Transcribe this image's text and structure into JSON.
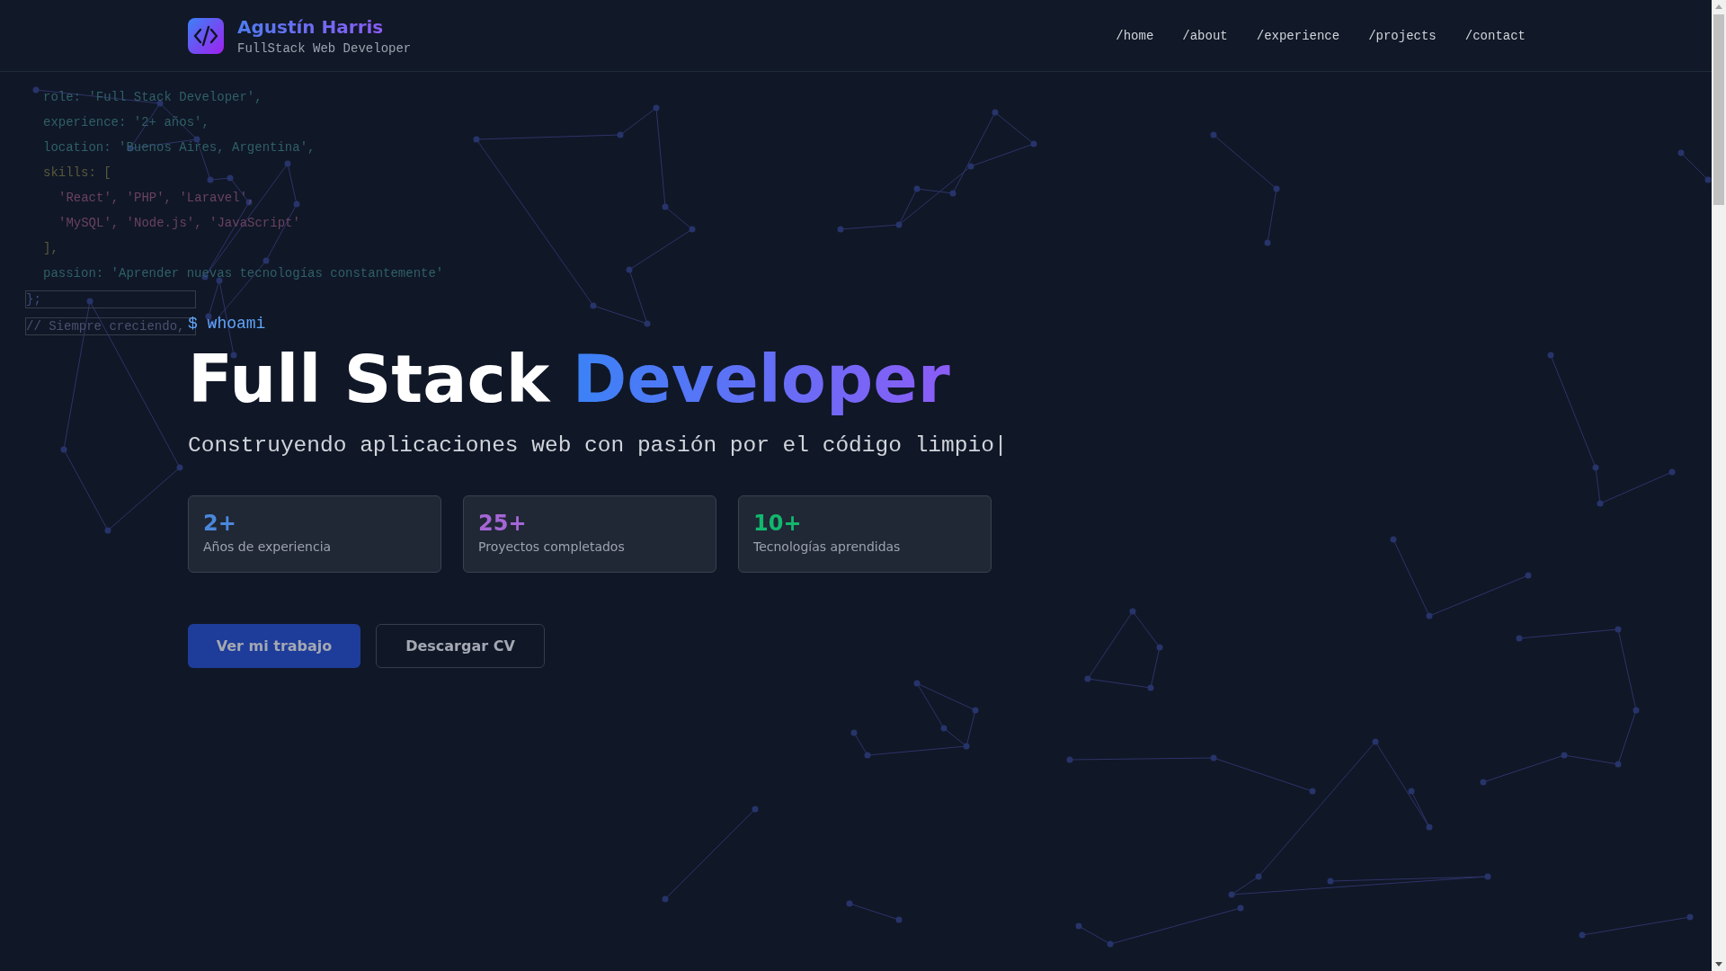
{
  "header": {
    "name": "Agustín Harris",
    "subtitle": "FullStack Web Developer",
    "nav": [
      {
        "label": "/home"
      },
      {
        "label": "/about"
      },
      {
        "label": "/experience"
      },
      {
        "label": "/projects"
      },
      {
        "label": "/contact"
      }
    ]
  },
  "code_lines": [
    {
      "text": "role: 'Full Stack Developer',",
      "color": "#2f6066",
      "kind": "prop"
    },
    {
      "text": "experience: '2+ años',",
      "color": "#2f6066",
      "kind": "prop"
    },
    {
      "text": "location: 'Buenos Aires, Argentina',",
      "color": "#2f6066",
      "kind": "prop"
    },
    {
      "text": "skills: [",
      "color": "#5a5a3a",
      "kind": "prop"
    },
    {
      "text": "'React', 'PHP', 'Laravel',",
      "color": "#6a4260",
      "kind": "item"
    },
    {
      "text": "'MySQL', 'Node.js', 'JavaScript'",
      "color": "#6a4260",
      "kind": "item"
    },
    {
      "text": "],",
      "color": "#5a5a3a",
      "kind": "prop"
    },
    {
      "text": "passion: 'Aprender nuevas tecnologías constantemente'",
      "color": "#2f6066",
      "kind": "prop"
    },
    {
      "text": "};",
      "color": "#3d4f80",
      "kind": "outer"
    },
    {
      "text": "// Siempre creciendo,",
      "color": "#4a5170",
      "kind": "outer"
    }
  ],
  "hero": {
    "prompt": "$ whoami",
    "title_plain": "Full Stack",
    "title_accent": "Developer",
    "tagline": "Construyendo aplicaciones web con pasión por el código limpio|"
  },
  "stats": [
    {
      "value": "2+",
      "label": "Años de experiencia",
      "color": "#4a88dc"
    },
    {
      "value": "25+",
      "label": "Proyectos completados",
      "color": "#a466d6"
    },
    {
      "value": "10+",
      "label": "Tecnologías aprendidas",
      "color": "#12b76e"
    }
  ],
  "buttons": [
    {
      "label": "Ver mi trabajo",
      "kind": "primary"
    },
    {
      "label": "Descargar CV",
      "kind": "outline"
    }
  ]
}
